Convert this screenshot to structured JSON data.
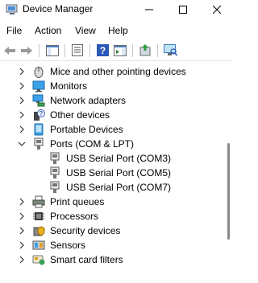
{
  "window": {
    "title": "Device Manager"
  },
  "menu": {
    "file": "File",
    "action": "Action",
    "view": "View",
    "help": "Help"
  },
  "toolbar": {
    "icons": [
      "back-arrow-icon",
      "forward-arrow-icon",
      "console-tree-icon",
      "properties-icon",
      "help-icon",
      "action-pane-icon",
      "update-driver-icon",
      "scan-hardware-icon"
    ]
  },
  "tree": {
    "items": [
      {
        "label": "Mice and other pointing devices",
        "icon": "mouse-icon",
        "expanded": false
      },
      {
        "label": "Monitors",
        "icon": "monitor-icon",
        "expanded": false
      },
      {
        "label": "Network adapters",
        "icon": "network-adapter-icon",
        "expanded": false
      },
      {
        "label": "Other devices",
        "icon": "other-devices-icon",
        "expanded": false
      },
      {
        "label": "Portable Devices",
        "icon": "portable-device-icon",
        "expanded": false
      },
      {
        "label": "Ports (COM & LPT)",
        "icon": "port-icon",
        "expanded": true
      },
      {
        "label": "USB Serial Port (COM3)",
        "icon": "port-icon",
        "child": true
      },
      {
        "label": "USB Serial Port (COM5)",
        "icon": "port-icon",
        "child": true
      },
      {
        "label": "USB Serial Port (COM7)",
        "icon": "port-icon",
        "child": true
      },
      {
        "label": "Print queues",
        "icon": "printer-icon",
        "expanded": false
      },
      {
        "label": "Processors",
        "icon": "processor-icon",
        "expanded": false
      },
      {
        "label": "Security devices",
        "icon": "security-device-icon",
        "expanded": false
      },
      {
        "label": "Sensors",
        "icon": "sensor-icon",
        "expanded": false
      },
      {
        "label": "Smart card filters",
        "icon": "smart-card-icon",
        "expanded": false
      }
    ]
  }
}
